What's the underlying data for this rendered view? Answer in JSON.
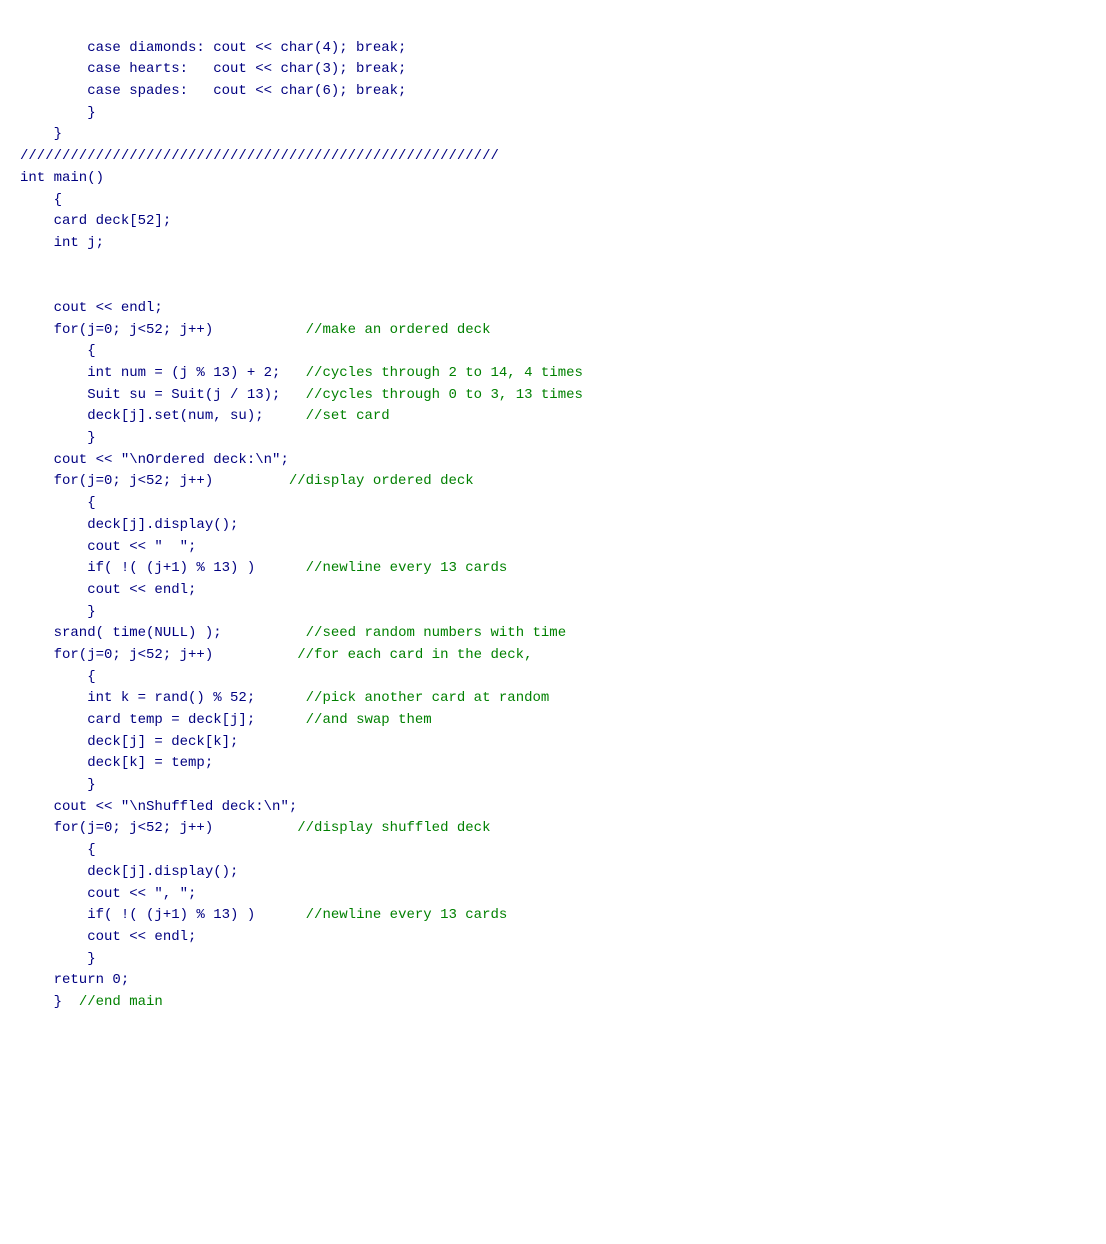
{
  "code": {
    "lines": [
      {
        "id": 1,
        "indent": "        ",
        "code": "case diamonds: cout << char(4); break;"
      },
      {
        "id": 2,
        "indent": "        ",
        "code": "case hearts:   cout << char(3); break;"
      },
      {
        "id": 3,
        "indent": "        ",
        "code": "case spades:   cout << char(6); break;"
      },
      {
        "id": 4,
        "indent": "        ",
        "code": "}"
      },
      {
        "id": 5,
        "indent": "    ",
        "code": "}"
      },
      {
        "id": 6,
        "indent": "",
        "code": "/////////////////////////////////////////////////////////"
      },
      {
        "id": 7,
        "indent": "",
        "code": "int main()"
      },
      {
        "id": 8,
        "indent": "    ",
        "code": "{"
      },
      {
        "id": 9,
        "indent": "    ",
        "code": "card deck[52];"
      },
      {
        "id": 10,
        "indent": "    ",
        "code": "int j;"
      },
      {
        "id": 11,
        "indent": "",
        "code": ""
      },
      {
        "id": 12,
        "indent": "    ",
        "code": "cout << endl;"
      },
      {
        "id": 13,
        "indent": "    ",
        "code": "for(j=0; j&lt52; j++)           //make an ordered deck"
      },
      {
        "id": 14,
        "indent": "        ",
        "code": "{"
      },
      {
        "id": 15,
        "indent": "        ",
        "code": "int num = (j % 13) + 2;   //cycles through 2 to 14, 4 times"
      },
      {
        "id": 16,
        "indent": "        ",
        "code": "Suit su = Suit(j / 13);   //cycles through 0 to 3, 13 times"
      },
      {
        "id": 17,
        "indent": "        ",
        "code": "deck[j].set(num, su);     //set card"
      },
      {
        "id": 18,
        "indent": "        ",
        "code": "}"
      },
      {
        "id": 19,
        "indent": "    ",
        "code": "cout << \"\\nOrdered deck:\\n\";"
      },
      {
        "id": 20,
        "indent": "    ",
        "code": "for(j=0; j&lt52; j++)         //display ordered deck"
      },
      {
        "id": 21,
        "indent": "        ",
        "code": "{"
      },
      {
        "id": 22,
        "indent": "        ",
        "code": "deck[j].display();"
      },
      {
        "id": 23,
        "indent": "        ",
        "code": "cout << \"  \";"
      },
      {
        "id": 24,
        "indent": "        ",
        "code": "if( !( (j+1) % 13) )      //newline every 13 cards"
      },
      {
        "id": 25,
        "indent": "        ",
        "code": "cout << endl;"
      },
      {
        "id": 26,
        "indent": "        ",
        "code": "}"
      },
      {
        "id": 27,
        "indent": "    ",
        "code": "srand( time(NULL) );          //seed random numbers with time"
      },
      {
        "id": 28,
        "indent": "    ",
        "code": "for(j=0; j&lt52; j++)          //for each card in the deck,"
      },
      {
        "id": 29,
        "indent": "        ",
        "code": "{"
      },
      {
        "id": 30,
        "indent": "        ",
        "code": "int k = rand() % 52;      //pick another card at random"
      },
      {
        "id": 31,
        "indent": "        ",
        "code": "card temp = deck[j];      //and swap them"
      },
      {
        "id": 32,
        "indent": "        ",
        "code": "deck[j] = deck[k];"
      },
      {
        "id": 33,
        "indent": "        ",
        "code": "deck[k] = temp;"
      },
      {
        "id": 34,
        "indent": "        ",
        "code": "}"
      },
      {
        "id": 35,
        "indent": "    ",
        "code": "cout << \"\\nShuffled deck:\\n\";"
      },
      {
        "id": 36,
        "indent": "    ",
        "code": "for(j=0; j&lt52; j++)          //display shuffled deck"
      },
      {
        "id": 37,
        "indent": "        ",
        "code": "{"
      },
      {
        "id": 38,
        "indent": "        ",
        "code": "deck[j].display();"
      },
      {
        "id": 39,
        "indent": "        ",
        "code": "cout << \", \";"
      },
      {
        "id": 40,
        "indent": "        ",
        "code": "if( !( (j+1) % 13) )      //newline every 13 cards"
      },
      {
        "id": 41,
        "indent": "        ",
        "code": "cout << endl;"
      },
      {
        "id": 42,
        "indent": "        ",
        "code": "}"
      },
      {
        "id": 43,
        "indent": "    ",
        "code": "return 0;"
      },
      {
        "id": 44,
        "indent": "    ",
        "code": "}   //end main"
      }
    ]
  }
}
